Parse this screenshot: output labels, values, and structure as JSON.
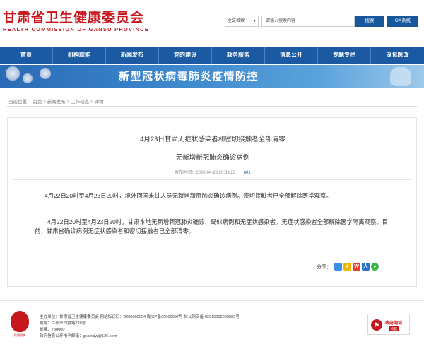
{
  "header": {
    "site_name": "甘肃省卫生健康委员会",
    "site_name_en": "HEALTH COMMISSION OF GANSU PROVINCE",
    "search_scope": "全文检索",
    "search_placeholder": "请输入搜索内容",
    "search_button": "搜索",
    "oa_button": "OA系统"
  },
  "nav": {
    "items": [
      "首页",
      "机构职能",
      "新闻发布",
      "党的建设",
      "政务服务",
      "信息公开",
      "专题专栏",
      "深化医改"
    ]
  },
  "banner": {
    "text": "新型冠状病毒肺炎疫情防控"
  },
  "breadcrumb": {
    "prefix": "当前位置：",
    "items": [
      "首页",
      "新闻发布",
      "工作动态",
      "详情"
    ],
    "separator": ">"
  },
  "article": {
    "title_line1": "4月23日甘肃无症状感染者和密切接触者全部清零",
    "title_line2": "无新增新冠肺炎确诊病例",
    "publish_label": "发布时间：",
    "publish_time": "2020-04-23 20:33:23",
    "views": "601",
    "paragraph1": "4月22日20时至4月23日20时，境外回国来甘人员无新增新冠肺炎确诊病例。密切接触者已全部解除医学观察。",
    "paragraph2": "4月22日20时至4月23日20时，甘肃本地无新增新冠肺炎确诊、疑似病例和无症状感染者。无症状感染者全部解除医学隔离观察。目前，甘肃省确诊病例无症状感染者和密切接触者已全部清零。",
    "share_label": "分享："
  },
  "footer": {
    "line1": "主办单位：甘肃省卫生健康委员会    网站标识码：6200000054    陇ICP备05000097号    甘公网安备 62010002000505号",
    "line2": "地址：兰州市白银路220号",
    "line3": "邮编：730000",
    "line4": "政府信息公开电子邮箱：gssswjw@126.com",
    "emblem_label": "党政机关",
    "badge_text": "政府网站",
    "badge_sub": "找错"
  },
  "colors": {
    "brand_red": "#c8161d",
    "nav_blue": "#1b5aa3"
  }
}
